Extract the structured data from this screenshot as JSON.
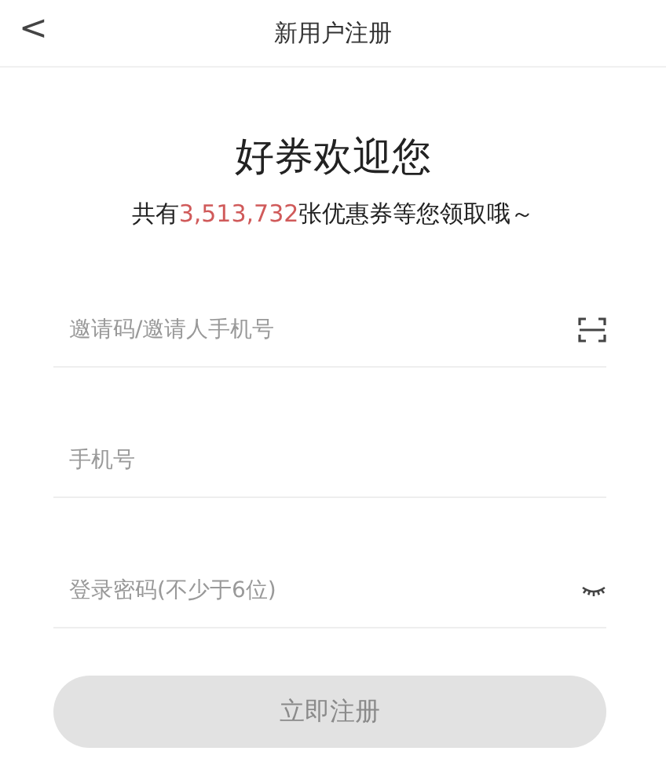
{
  "header": {
    "back": "<",
    "title": "新用户注册"
  },
  "welcome": {
    "title": "好券欢迎您",
    "subtitle": {
      "prefix": "共有",
      "count": "3,513,732",
      "suffix": "张优惠券等您领取哦～"
    }
  },
  "fields": [
    {
      "kind": "scan",
      "placeholder": "邀请码/邀请人手机号"
    },
    {
      "kind": "plain",
      "placeholder": "手机号"
    },
    {
      "kind": "password",
      "placeholder": "登录密码(不少于6位)"
    }
  ],
  "submit": {
    "label": "立即注册",
    "disabled": true
  }
}
